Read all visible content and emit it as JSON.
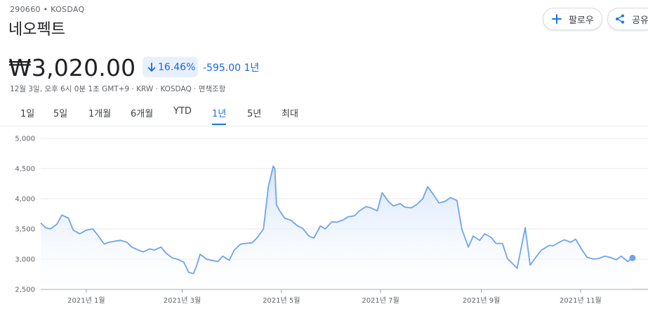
{
  "header": {
    "ticker": "290660 • KOSDAQ",
    "company": "네오펙트",
    "follow_label": "팔로우",
    "share_label": "공유"
  },
  "quote": {
    "price": "₩3,020.00",
    "change_pct": "16.46%",
    "change_abs": "-595.00 1년",
    "meta": "12월 3일, 오후 6시 0분 1초 GMT+9 · KRW · KOSDAQ · 면책조항"
  },
  "tabs": [
    {
      "label": "1일",
      "active": false
    },
    {
      "label": "5일",
      "active": false
    },
    {
      "label": "1개월",
      "active": false
    },
    {
      "label": "6개월",
      "active": false
    },
    {
      "label": "YTD",
      "active": false
    },
    {
      "label": "1년",
      "active": true
    },
    {
      "label": "5년",
      "active": false
    },
    {
      "label": "최대",
      "active": false
    }
  ],
  "colors": {
    "line": "#6ea4ee",
    "fill_top": "#cfe0fb",
    "accent": "#1a73e8",
    "change": "#1967d2"
  },
  "chart_data": {
    "type": "area",
    "ylim": [
      2500,
      5000
    ],
    "yticks": [
      "5,000",
      "4,500",
      "4,000",
      "3,500",
      "3,000",
      "2,500"
    ],
    "ytick_values": [
      5000,
      4500,
      4000,
      3500,
      3000,
      2500
    ],
    "xticks": [
      "2021년 1월",
      "2021년 3월",
      "2021년 5월",
      "2021년 7월",
      "2021년 9월",
      "2021년 11월"
    ],
    "xtick_dates": [
      "2021-01-01",
      "2021-03-01",
      "2021-05-01",
      "2021-07-01",
      "2021-09-01",
      "2021-11-01"
    ],
    "series": [
      {
        "x": [
          "2020-12-04",
          "2020-12-07",
          "2020-12-10",
          "2020-12-14",
          "2020-12-17",
          "2020-12-21",
          "2020-12-24",
          "2020-12-28",
          "2021-01-01",
          "2021-01-05",
          "2021-01-08",
          "2021-01-12",
          "2021-01-15",
          "2021-01-19",
          "2021-01-22",
          "2021-01-26",
          "2021-01-29",
          "2021-02-02",
          "2021-02-05",
          "2021-02-09",
          "2021-02-12",
          "2021-02-16",
          "2021-02-19",
          "2021-02-23",
          "2021-02-26",
          "2021-03-02",
          "2021-03-05",
          "2021-03-08",
          "2021-03-10",
          "2021-03-12",
          "2021-03-16",
          "2021-03-19",
          "2021-03-23",
          "2021-03-26",
          "2021-03-30",
          "2021-04-02",
          "2021-04-06",
          "2021-04-09",
          "2021-04-13",
          "2021-04-16",
          "2021-04-20",
          "2021-04-23",
          "2021-04-26",
          "2021-04-27",
          "2021-04-28",
          "2021-04-30",
          "2021-05-03",
          "2021-05-07",
          "2021-05-11",
          "2021-05-14",
          "2021-05-18",
          "2021-05-21",
          "2021-05-25",
          "2021-05-28",
          "2021-06-01",
          "2021-06-04",
          "2021-06-08",
          "2021-06-11",
          "2021-06-15",
          "2021-06-18",
          "2021-06-22",
          "2021-06-25",
          "2021-06-29",
          "2021-07-02",
          "2021-07-06",
          "2021-07-09",
          "2021-07-13",
          "2021-07-16",
          "2021-07-20",
          "2021-07-23",
          "2021-07-27",
          "2021-07-30",
          "2021-08-03",
          "2021-08-06",
          "2021-08-10",
          "2021-08-13",
          "2021-08-17",
          "2021-08-20",
          "2021-08-24",
          "2021-08-27",
          "2021-08-31",
          "2021-09-03",
          "2021-09-07",
          "2021-09-10",
          "2021-09-14",
          "2021-09-17",
          "2021-09-23",
          "2021-09-28",
          "2021-10-01",
          "2021-10-05",
          "2021-10-08",
          "2021-10-13",
          "2021-10-15",
          "2021-10-19",
          "2021-10-22",
          "2021-10-26",
          "2021-10-29",
          "2021-11-02",
          "2021-11-05",
          "2021-11-09",
          "2021-11-12",
          "2021-11-16",
          "2021-11-19",
          "2021-11-23",
          "2021-11-26",
          "2021-11-30",
          "2021-12-03"
        ],
        "values": [
          3600,
          3520,
          3500,
          3580,
          3730,
          3680,
          3480,
          3420,
          3480,
          3500,
          3400,
          3250,
          3280,
          3300,
          3310,
          3280,
          3200,
          3150,
          3120,
          3170,
          3150,
          3200,
          3100,
          3020,
          3000,
          2950,
          2780,
          2760,
          2900,
          3080,
          3000,
          2980,
          2960,
          3050,
          2980,
          3150,
          3250,
          3260,
          3270,
          3350,
          3500,
          4200,
          4540,
          4500,
          3900,
          3800,
          3680,
          3640,
          3550,
          3510,
          3380,
          3350,
          3550,
          3500,
          3620,
          3610,
          3650,
          3700,
          3720,
          3800,
          3870,
          3850,
          3800,
          4100,
          3950,
          3880,
          3920,
          3860,
          3850,
          3900,
          4000,
          4200,
          4050,
          3930,
          3960,
          4020,
          3970,
          3500,
          3200,
          3380,
          3310,
          3420,
          3360,
          3260,
          3260,
          3010,
          2850,
          3520,
          2900,
          3050,
          3150,
          3230,
          3220,
          3280,
          3320,
          3280,
          3330,
          3150,
          3030,
          3000,
          3010,
          3050,
          3030,
          2990,
          3050,
          2960,
          3020
        ]
      }
    ]
  }
}
